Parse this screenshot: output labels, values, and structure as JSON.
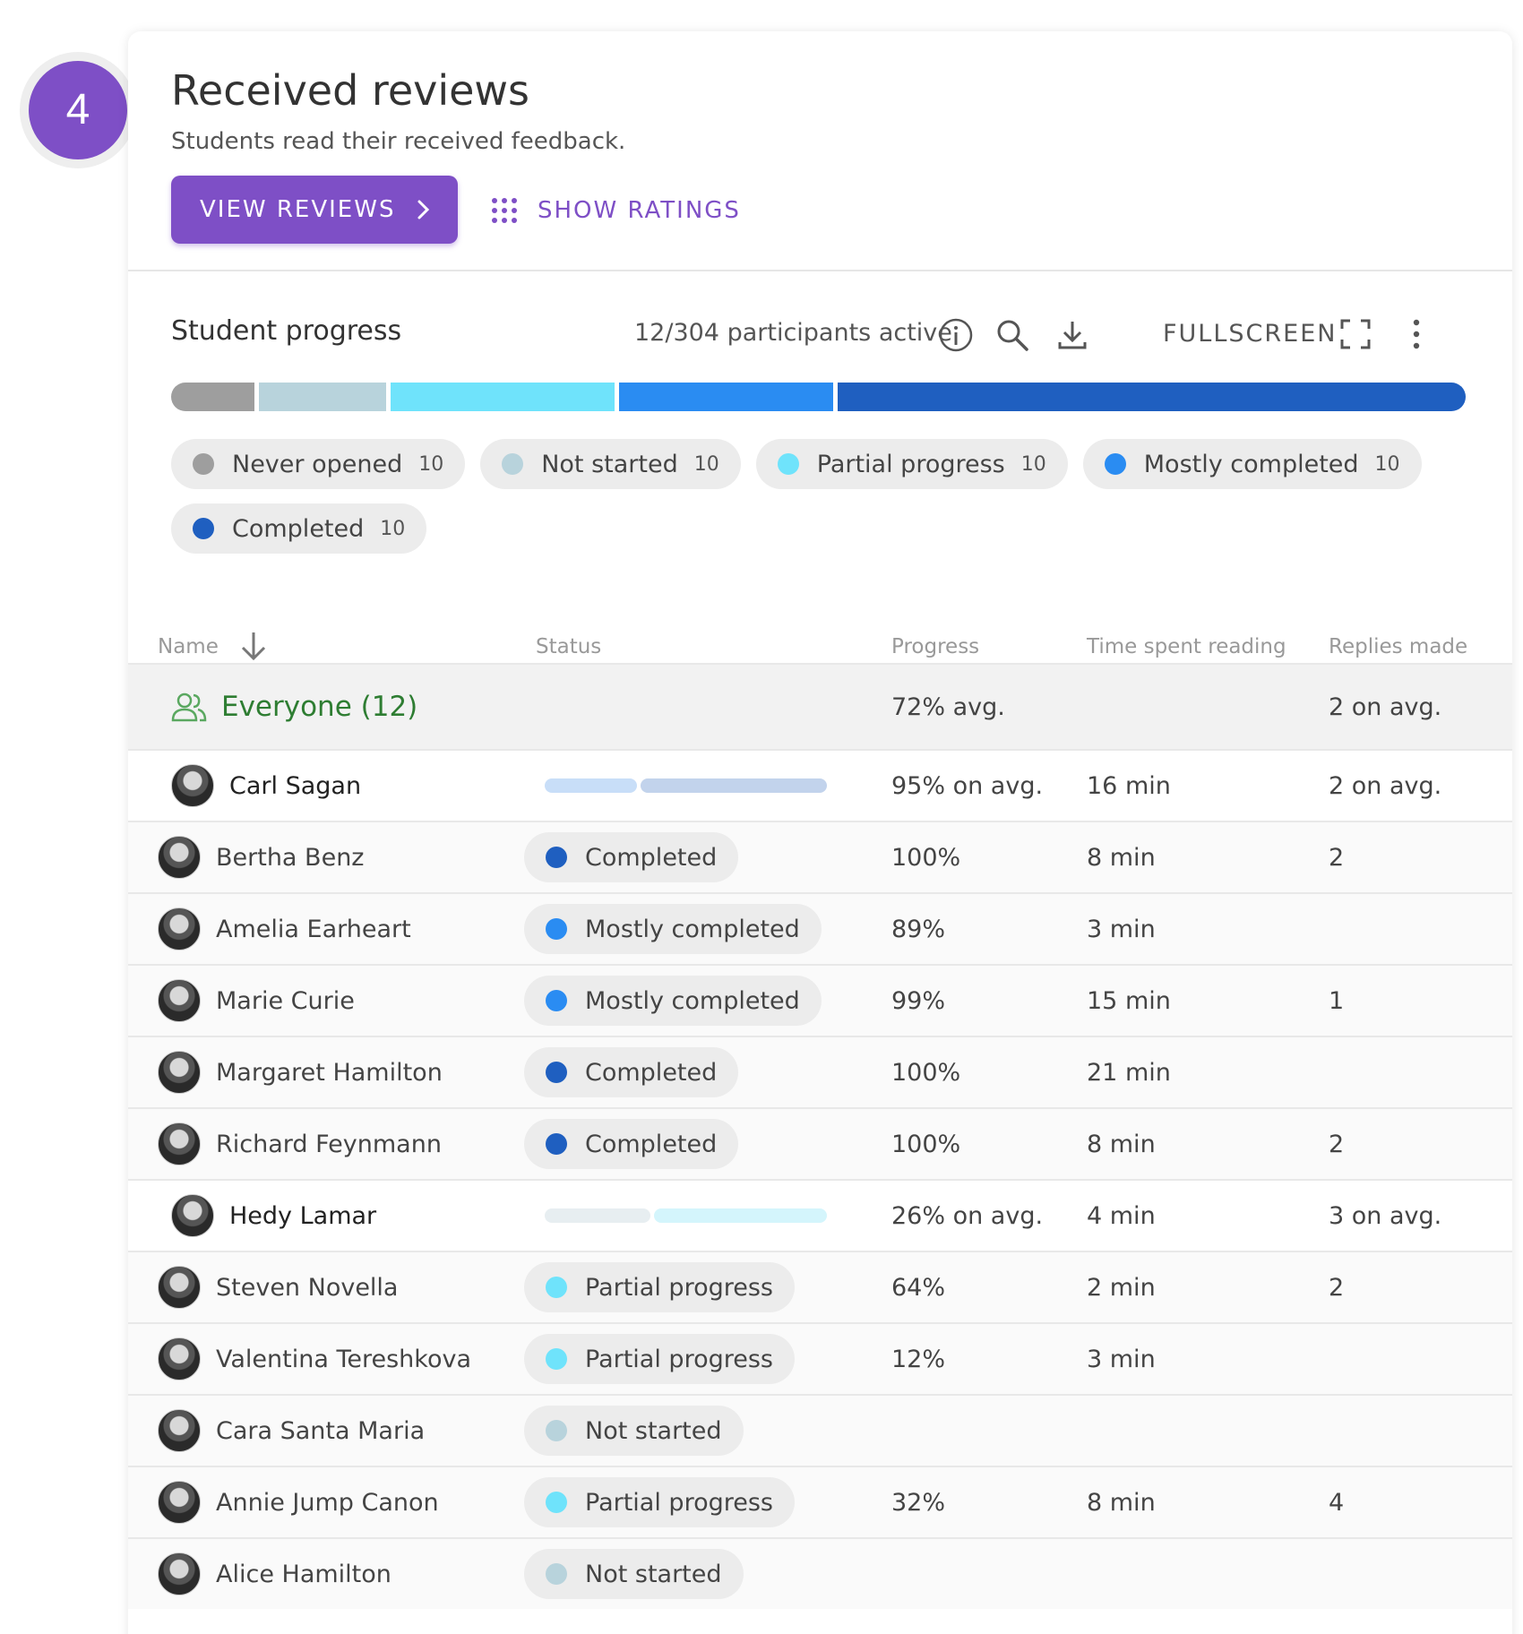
{
  "step": {
    "number": "4"
  },
  "header": {
    "title": "Received reviews",
    "subtitle": "Students read their received feedback.",
    "primary_button": "VIEW REVIEWS",
    "secondary_button": "SHOW RATINGS"
  },
  "progress": {
    "title": "Student progress",
    "active_text": "12/304 participants active",
    "fullscreen_label": "FULLSCREEN",
    "colors": {
      "never_opened": "#9e9e9e",
      "not_started": "#b8d3dc",
      "partial_progress": "#6fe3fb",
      "mostly_completed": "#2a8cf2",
      "completed": "#1f5fc0"
    },
    "legend": [
      {
        "label": "Never opened",
        "count": "10",
        "color": "#9e9e9e",
        "fraction": 0.065
      },
      {
        "label": "Not started",
        "count": "10",
        "color": "#b8d3dc",
        "fraction": 0.1
      },
      {
        "label": "Partial progress",
        "count": "10",
        "color": "#6fe3fb",
        "fraction": 0.175
      },
      {
        "label": "Mostly completed",
        "count": "10",
        "color": "#2a8cf2",
        "fraction": 0.168
      },
      {
        "label": "Completed",
        "count": "10",
        "color": "#1f5fc0",
        "fraction": 0.492
      }
    ]
  },
  "table": {
    "columns": [
      "Name",
      "Status",
      "Progress",
      "Time spent reading",
      "Replies made"
    ],
    "group": {
      "name": "Everyone (12)",
      "progress": "72% avg.",
      "replies": "2 on avg."
    },
    "rows": [
      {
        "type": "student",
        "name": "Carl Sagan",
        "progress": "95% on avg.",
        "time": "16 min",
        "replies": "2 on avg.",
        "bar": [
          {
            "fraction": 0.33,
            "color": "#c8def8"
          },
          {
            "fraction": 0.67,
            "color": "#c2d3ec"
          }
        ]
      },
      {
        "type": "child",
        "name": "Bertha Benz",
        "status": "Completed",
        "status_color": "#1f5fc0",
        "progress": "100%",
        "time": "8 min",
        "replies": "2"
      },
      {
        "type": "child",
        "name": "Amelia Earheart",
        "status": "Mostly completed",
        "status_color": "#2a8cf2",
        "progress": "89%",
        "time": "3 min",
        "replies": ""
      },
      {
        "type": "child",
        "name": "Marie Curie",
        "status": "Mostly completed",
        "status_color": "#2a8cf2",
        "progress": "99%",
        "time": "15 min",
        "replies": "1"
      },
      {
        "type": "child",
        "name": "Margaret Hamilton",
        "status": "Completed",
        "status_color": "#1f5fc0",
        "progress": "100%",
        "time": "21 min",
        "replies": ""
      },
      {
        "type": "child",
        "name": "Richard Feynmann",
        "status": "Completed",
        "status_color": "#1f5fc0",
        "progress": "100%",
        "time": "8 min",
        "replies": "2"
      },
      {
        "type": "student",
        "name": "Hedy Lamar",
        "progress": "26% on avg.",
        "time": "4 min",
        "replies": "3 on avg.",
        "bar": [
          {
            "fraction": 0.38,
            "color": "#e7eef1"
          },
          {
            "fraction": 0.62,
            "color": "#d4f5fc"
          }
        ]
      },
      {
        "type": "child",
        "name": "Steven Novella",
        "status": "Partial progress",
        "status_color": "#6fe3fb",
        "progress": "64%",
        "time": "2 min",
        "replies": "2"
      },
      {
        "type": "child",
        "name": "Valentina Tereshkova",
        "status": "Partial progress",
        "status_color": "#6fe3fb",
        "progress": "12%",
        "time": "3 min",
        "replies": ""
      },
      {
        "type": "child",
        "name": "Cara Santa Maria",
        "status": "Not started",
        "status_color": "#b8d3dc",
        "progress": "",
        "time": "",
        "replies": ""
      },
      {
        "type": "child",
        "name": "Annie Jump Canon",
        "status": "Partial progress",
        "status_color": "#6fe3fb",
        "progress": "32%",
        "time": "8 min",
        "replies": "4"
      },
      {
        "type": "child",
        "name": "Alice Hamilton",
        "status": "Not started",
        "status_color": "#b8d3dc",
        "progress": "",
        "time": "",
        "replies": ""
      }
    ]
  }
}
